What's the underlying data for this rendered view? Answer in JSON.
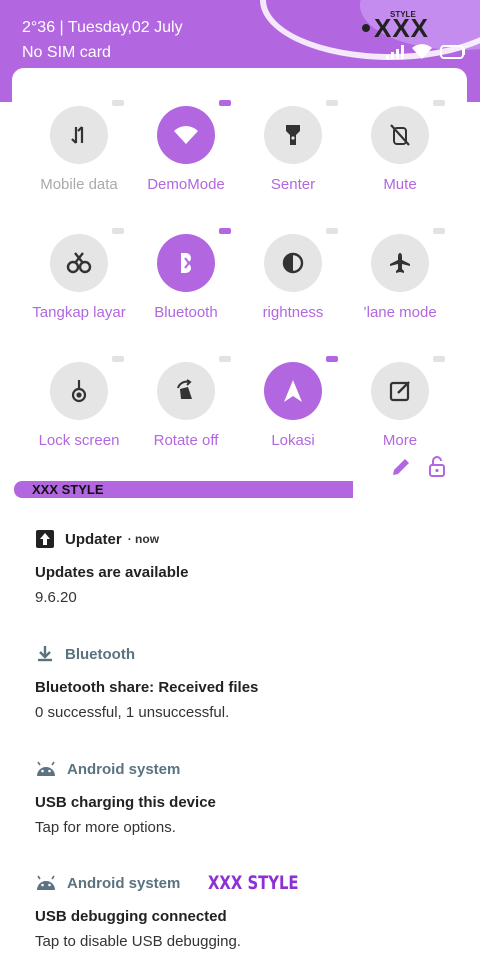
{
  "status_bar": {
    "datetime": "2°36 | Tuesday,02 July",
    "sim": "No SIM card",
    "brand_small": "STYLE",
    "brand_big": "XXX"
  },
  "colors": {
    "accent": "#b267e0",
    "tile_off": "#e5e5e5",
    "app_slate": "#5b7380"
  },
  "tiles": [
    {
      "label": "Mobile data",
      "icon": "mobile-data-icon",
      "state": "off"
    },
    {
      "label": "DemoMode",
      "icon": "wifi-icon",
      "state": "on"
    },
    {
      "label": "Senter",
      "icon": "flashlight-icon",
      "state": "off"
    },
    {
      "label": "Mute",
      "icon": "mute-icon",
      "state": "off"
    },
    {
      "label": "Tangkap layar",
      "icon": "screenshot-icon",
      "state": "off"
    },
    {
      "label": "Bluetooth",
      "icon": "bluetooth-icon",
      "state": "on"
    },
    {
      "label": "rightness",
      "icon": "brightness-icon",
      "state": "off"
    },
    {
      "label": "’lane mode",
      "icon": "airplane-icon",
      "state": "off"
    },
    {
      "label": "Lock screen",
      "icon": "lock-screen-icon",
      "state": "off"
    },
    {
      "label": "Rotate off",
      "icon": "rotate-icon",
      "state": "off"
    },
    {
      "label": "Lokasi",
      "icon": "location-icon",
      "state": "on"
    },
    {
      "label": "More",
      "icon": "more-edit-icon",
      "state": "off"
    }
  ],
  "brand_bar": "XXX STYLE",
  "notifications": [
    {
      "app": "Updater",
      "time": "now",
      "title": "Updates are available",
      "text": "9.6.20"
    },
    {
      "app": "Bluetooth",
      "title": "Bluetooth share: Received files",
      "text": "0 successful, 1 unsuccessful."
    },
    {
      "app": "Android system",
      "title": "USB charging this device",
      "text": "Tap for more options."
    },
    {
      "app": "Android system",
      "title": "USB debugging connected",
      "text": "Tap to disable USB debugging."
    }
  ],
  "watermark": "XXX STYLE"
}
